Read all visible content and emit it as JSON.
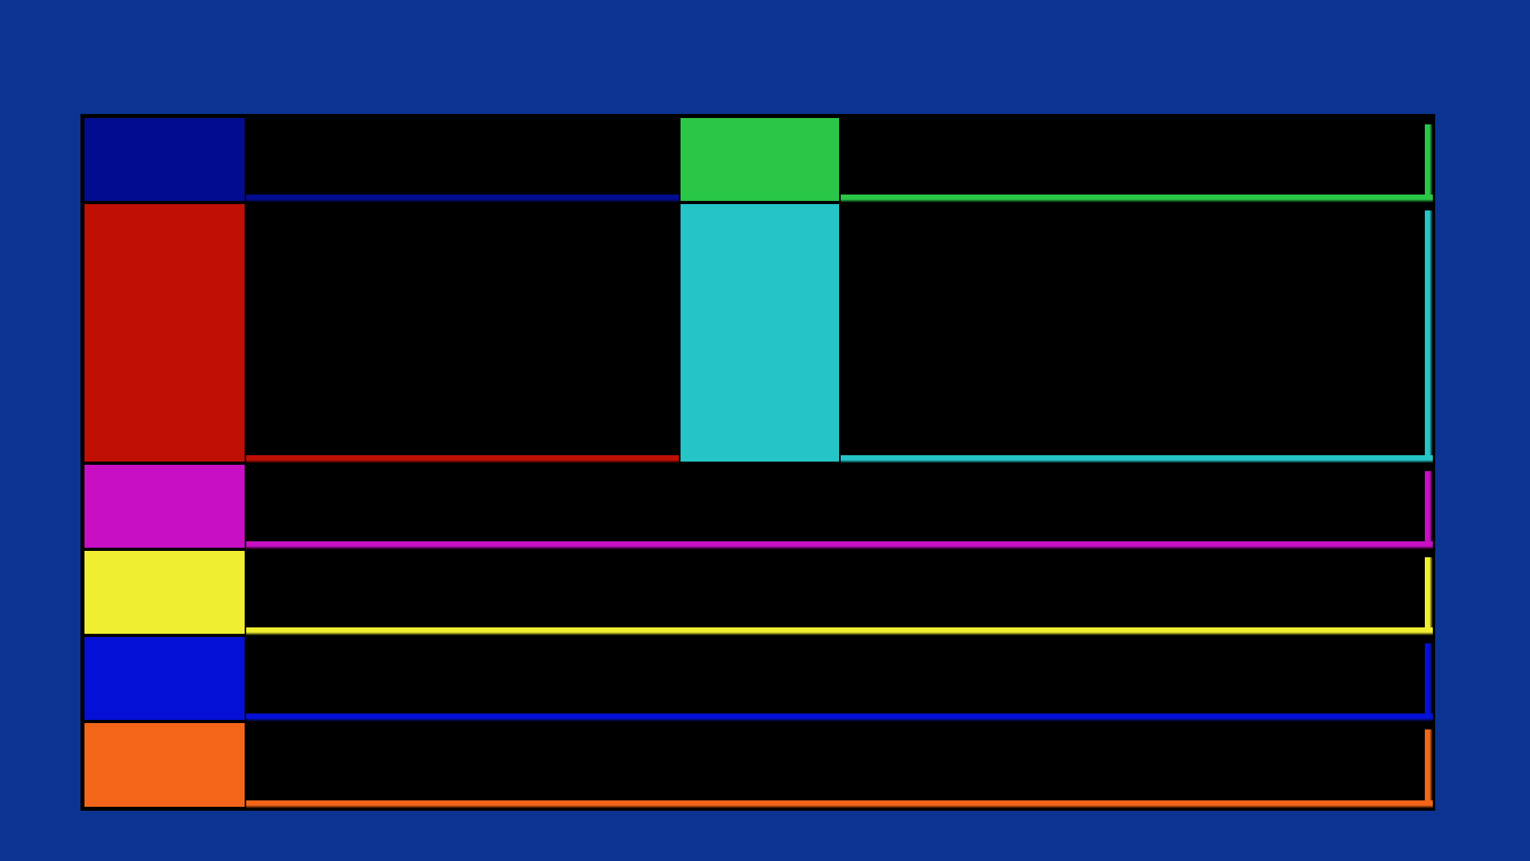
{
  "colors": {
    "background": "#0b3391",
    "navy": "#020c8f",
    "green": "#2ac648",
    "red": "#c00f05",
    "cyan": "#25c4c7",
    "magenta": "#c80fc4",
    "yellow": "#f0ee31",
    "blue": "#0410d6",
    "orange": "#f3661a"
  },
  "tiles": [
    {
      "name": "navy-tile",
      "color": "navy"
    },
    {
      "name": "green-tile",
      "color": "green"
    },
    {
      "name": "red-tile",
      "color": "red"
    },
    {
      "name": "cyan-tile",
      "color": "cyan"
    },
    {
      "name": "magenta-tile",
      "color": "magenta"
    },
    {
      "name": "yellow-tile",
      "color": "yellow"
    },
    {
      "name": "blue-tile",
      "color": "blue"
    },
    {
      "name": "orange-tile",
      "color": "orange"
    }
  ]
}
